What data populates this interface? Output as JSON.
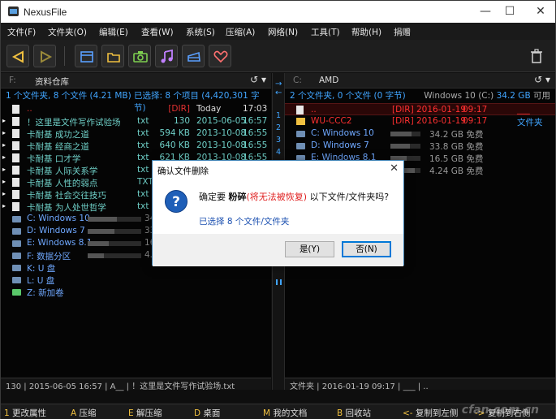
{
  "window": {
    "title": "NexusFile",
    "minimize": "—",
    "maximize": "☐",
    "close": "✕"
  },
  "menu": [
    "文件(F)",
    "文件夹(O)",
    "编辑(E)",
    "查看(W)",
    "系统(S)",
    "压缩(A)",
    "网络(N)",
    "工具(T)",
    "帮助(H)",
    "捐赠"
  ],
  "toolbar": {
    "buttons": [
      {
        "name": "back-button",
        "icon": "triangle-left-icon"
      },
      {
        "name": "forward-button",
        "icon": "triangle-right-icon"
      },
      {
        "name": "panel-button",
        "icon": "window-icon"
      },
      {
        "name": "folder-button",
        "icon": "folder-icon"
      },
      {
        "name": "camera-button",
        "icon": "camera-icon"
      },
      {
        "name": "music-button",
        "icon": "music-icon"
      },
      {
        "name": "card-button",
        "icon": "card-icon"
      },
      {
        "name": "favorites-button",
        "icon": "heart-icon"
      },
      {
        "name": "trash-button",
        "icon": "trash-icon"
      }
    ]
  },
  "left": {
    "drive": "F:",
    "path": "资料仓库",
    "controls": "↺ ▾",
    "status_a": "1 个文件夹, 8 个文件 (4.21 MB)",
    "status_b": "已选择: 8 个项目 (4,420,301 字节)",
    "files": [
      {
        "name": "..",
        "ext": "",
        "size": "[DIR]",
        "date": "Today",
        "time": "17:03",
        "kind": "up"
      },
      {
        "name": "！这里是文件写作试验场",
        "ext": "txt",
        "size": "130",
        "date": "2015-06-05",
        "time": "16:57",
        "kind": "sel"
      },
      {
        "name": "卡耐基 成功之道",
        "ext": "txt",
        "size": "594 KB",
        "date": "2013-10-08",
        "time": "16:55",
        "kind": "sel"
      },
      {
        "name": "卡耐基 经商之道",
        "ext": "txt",
        "size": "640 KB",
        "date": "2013-10-08",
        "time": "16:55",
        "kind": "sel"
      },
      {
        "name": "卡耐基 口才学",
        "ext": "txt",
        "size": "621 KB",
        "date": "2013-10-08",
        "time": "16:55",
        "kind": "sel"
      },
      {
        "name": "卡耐基 人际关系学",
        "ext": "txt",
        "size": "",
        "date": "",
        "time": "",
        "kind": "sel"
      },
      {
        "name": "卡耐基 人性的弱点",
        "ext": "TXT",
        "size": "",
        "date": "",
        "time": "",
        "kind": "sel"
      },
      {
        "name": "卡耐基 社会交往技巧",
        "ext": "txt",
        "size": "",
        "date": "",
        "time": "",
        "kind": "sel"
      },
      {
        "name": "卡耐基 为人处世哲学",
        "ext": "txt",
        "size": "",
        "date": "",
        "time": "",
        "kind": "sel"
      }
    ],
    "drives": [
      {
        "label": "C: Windows 10",
        "fill": 0.55,
        "tail": "34",
        "color": "drive"
      },
      {
        "label": "D: Windows 7",
        "fill": 0.5,
        "tail": "33",
        "color": "drive"
      },
      {
        "label": "E: Windows 8.1",
        "fill": 0.4,
        "tail": "16",
        "color": "drive"
      },
      {
        "label": "F: 数据分区",
        "fill": 0.3,
        "tail": "4.2",
        "color": "drive"
      },
      {
        "label": "K: U 盘",
        "fill": null,
        "tail": "",
        "color": "drive"
      },
      {
        "label": "L: U 盘",
        "fill": null,
        "tail": "",
        "color": "drive"
      },
      {
        "label": "Z: 新加卷",
        "fill": null,
        "tail": "",
        "color": "drive g"
      }
    ],
    "footer": "130 | 2015-06-05 16:57 | A__ | ！这里是文件写作试验场.txt"
  },
  "middle": {
    "arrows": "→",
    "arrow2": "←",
    "tabs": [
      "1",
      "2",
      "3",
      "4",
      "5",
      "6"
    ]
  },
  "right": {
    "drive": "C:",
    "path": "AMD",
    "controls": "↺ ▾",
    "status_a": "2 个文件夹, 0 个文件 (0 字节)",
    "status_b_label": "Windows 10 (C:)",
    "status_b_free": "34.2 GB",
    "status_b_suffix": "可用",
    "files": [
      {
        "name": "..",
        "size": "[DIR]",
        "date": "2016-01-19",
        "time": "09:17",
        "extra": "___",
        "kind": "up"
      },
      {
        "name": "WU-CCC2",
        "size": "[DIR]",
        "date": "2016-01-19",
        "time": "09:17",
        "extra": "文件夹",
        "kind": "dir"
      }
    ],
    "drives": [
      {
        "label": "C: Windows 10",
        "fill": 0.7,
        "free": "34.2 GB 免费"
      },
      {
        "label": "D: Windows 7",
        "fill": 0.65,
        "free": "33.8 GB 免费"
      },
      {
        "label": "E: Windows 8.1",
        "fill": 0.55,
        "free": "16.5 GB 免费"
      },
      {
        "label": "",
        "fill": 0.8,
        "free": "4.24 GB 免费"
      }
    ],
    "footer": "文件夹 | 2016-01-19 09:17 | ___ | .."
  },
  "fkeys": [
    {
      "key": "1",
      "label": "更改属性"
    },
    {
      "key": "A",
      "label": "压缩"
    },
    {
      "key": "E",
      "label": "解压缩"
    },
    {
      "key": "D",
      "label": "桌面"
    },
    {
      "key": "M",
      "label": "我的文档"
    },
    {
      "key": "B",
      "label": "回收站"
    },
    {
      "key": "<-",
      "label": "复制到左侧"
    },
    {
      "key": "->",
      "label": "复制到右侧"
    }
  ],
  "dialog": {
    "title": "确认文件删除",
    "close": "✕",
    "question_icon": "?",
    "msg_pre": "确定要",
    "msg_bold": "粉碎",
    "msg_red": "(将无法被恢复)",
    "msg_post": "以下文件/文件夹吗?",
    "sub": "已选择 8 个文件/文件夹",
    "yes": "是(Y)",
    "no": "否(N)"
  },
  "watermark": "cfan.com.cn",
  "colors": {
    "accent": "#41a5ff",
    "selected": "#6fd0c8",
    "dir": "#ff3030",
    "drive": "#6fa8ff",
    "dialog_border": "#3c7fb1"
  }
}
